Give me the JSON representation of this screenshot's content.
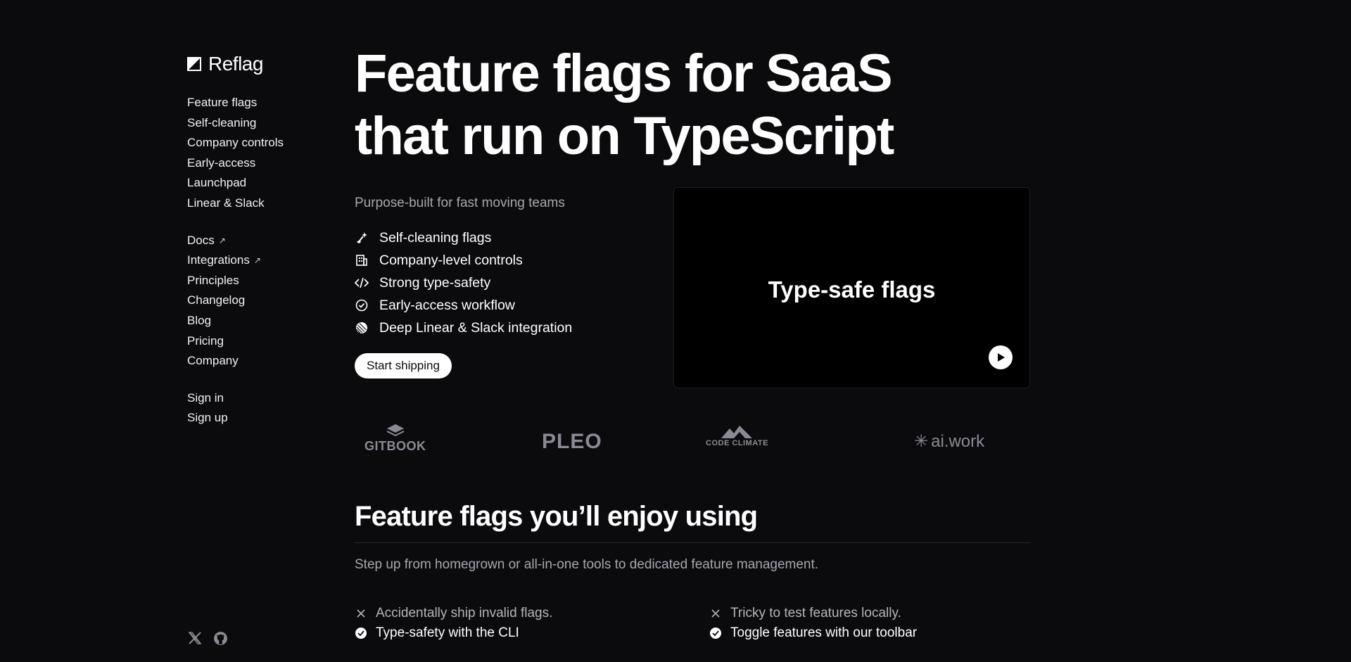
{
  "brand": {
    "name": "Reflag"
  },
  "nav": {
    "product": [
      {
        "label": "Feature flags"
      },
      {
        "label": "Self-cleaning"
      },
      {
        "label": "Company controls"
      },
      {
        "label": "Early-access"
      },
      {
        "label": "Launchpad"
      },
      {
        "label": "Linear & Slack"
      }
    ],
    "resources": [
      {
        "label": "Docs",
        "external": true
      },
      {
        "label": "Integrations",
        "external": true
      },
      {
        "label": "Principles"
      },
      {
        "label": "Changelog"
      },
      {
        "label": "Blog"
      },
      {
        "label": "Pricing"
      },
      {
        "label": "Company"
      }
    ],
    "account": [
      {
        "label": "Sign in"
      },
      {
        "label": "Sign up"
      }
    ],
    "external_glyph": "↗"
  },
  "social": {
    "icons": [
      "x-icon",
      "github-icon"
    ]
  },
  "hero": {
    "title_line1": "Feature flags for SaaS",
    "title_line2": "that run on TypeScript",
    "tagline": "Purpose-built for fast moving teams",
    "features": [
      {
        "label": "Self-cleaning flags",
        "icon": "broom-sparkle-icon"
      },
      {
        "label": "Company-level controls",
        "icon": "building-icon"
      },
      {
        "label": "Strong type-safety",
        "icon": "code-icon"
      },
      {
        "label": "Early-access workflow",
        "icon": "check-circle-icon"
      },
      {
        "label": "Deep Linear & Slack integration",
        "icon": "linear-icon"
      }
    ],
    "cta_label": "Start shipping",
    "video_title": "Type-safe flags"
  },
  "logos": [
    {
      "name": "gitbook-logo",
      "text": "GITBOOK"
    },
    {
      "name": "pleo-logo",
      "text": "PLEO"
    },
    {
      "name": "code-climate-logo",
      "text": "CODE CLIMATE"
    },
    {
      "name": "ai-work-logo",
      "text": "ai.work"
    }
  ],
  "section": {
    "title": "Feature flags you’ll enjoy using",
    "subtitle": "Step up from homegrown or all-in-one tools to dedicated feature management.",
    "compare": [
      {
        "bad": "Accidentally ship invalid flags.",
        "good": "Type-safety with the CLI"
      },
      {
        "bad": "Tricky to test features locally.",
        "good": "Toggle features with our toolbar"
      }
    ]
  },
  "colors": {
    "background": "#0b0b0e",
    "text": "#ffffff",
    "muted": "#a6a6b0",
    "logo": "#8a8a94"
  }
}
